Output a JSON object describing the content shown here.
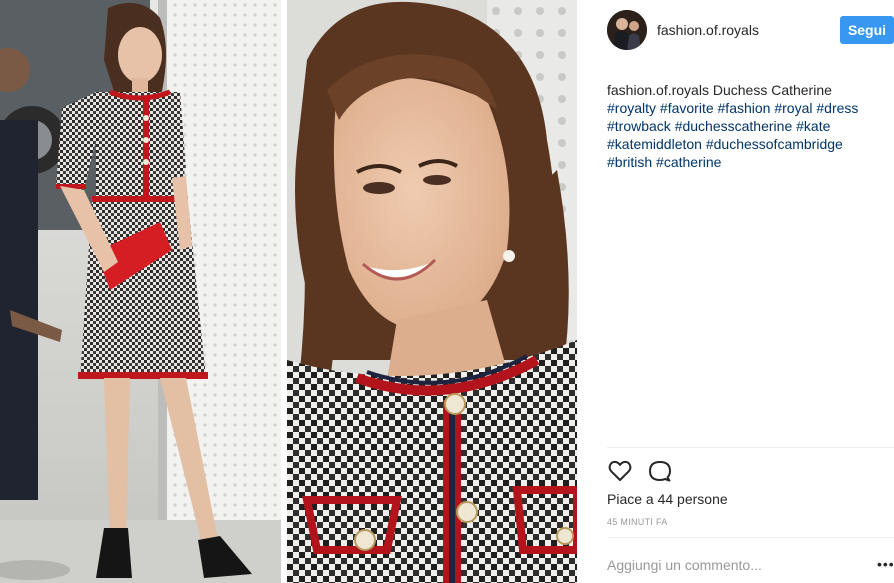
{
  "post": {
    "username": "fashion.of.royals",
    "follow_label": "Segui",
    "caption": {
      "author": "fashion.of.royals",
      "text": "Duchess Catherine",
      "hashtags": [
        "#royalty",
        "#favorite",
        "#fashion",
        "#royal",
        "#dress",
        "#trowback",
        "#duchesscatherine",
        "#kate",
        "#katemiddleton",
        "#duchessofcambridge",
        "#british",
        "#catherine"
      ]
    },
    "likes_text": "Piace a 44 persone",
    "timestamp": "45 MINUTI FA",
    "comment_placeholder": "Aggiungi un commento...",
    "more_label": "•••"
  },
  "icons": {
    "like": "heart-icon",
    "comment": "comment-icon",
    "more": "more-options-icon"
  },
  "colors": {
    "follow_button": "#3897f0",
    "hashtag": "#003569",
    "timestamp": "#999999",
    "divider": "#efefef"
  }
}
